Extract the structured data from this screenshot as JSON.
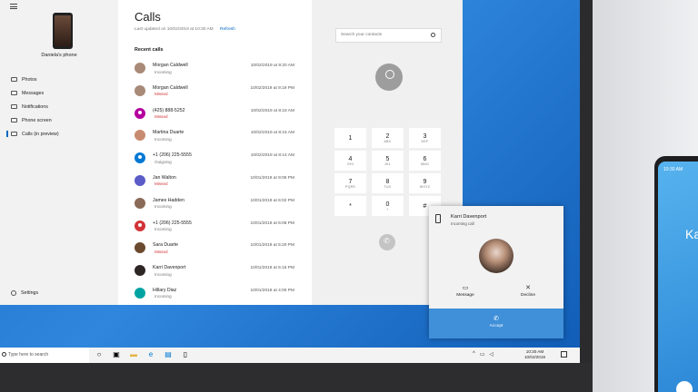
{
  "app": {
    "device_name": "Daniela's phone",
    "nav": [
      {
        "label": "Photos",
        "icon": "photos-icon"
      },
      {
        "label": "Messages",
        "icon": "messages-icon"
      },
      {
        "label": "Notifications",
        "icon": "notifications-icon"
      },
      {
        "label": "Phone screen",
        "icon": "phone-screen-icon"
      },
      {
        "label": "Calls (in preview)",
        "icon": "calls-icon",
        "active": true
      }
    ],
    "settings_label": "Settings"
  },
  "calls": {
    "title": "Calls",
    "last_updated": "Last updated on 10/02/2019 at 10:30 AM",
    "refresh_label": "Refresh",
    "recent_label": "Recent calls",
    "items": [
      {
        "name": "Morgan Caldwell",
        "type": "Incoming",
        "time": "10/02/2019 at 9:20 AM",
        "color": "#a88a78"
      },
      {
        "name": "Morgan Caldwell",
        "type": "Missed",
        "time": "10/02/2019 at 9:19 PM",
        "color": "#a88a78"
      },
      {
        "name": "(425) 888-5252",
        "type": "Missed",
        "time": "10/02/2019 at 8:18 AM",
        "color": "#b4009e"
      },
      {
        "name": "Martina Duarte",
        "type": "Incoming",
        "time": "10/02/2019 at 8:15 AM",
        "color": "#c98b6f"
      },
      {
        "name": "+1 (206) 225-5555",
        "type": "Outgoing",
        "time": "10/02/2019 at 8:14 AM",
        "color": "#0078d4"
      },
      {
        "name": "Jan Walton",
        "type": "Missed",
        "time": "10/01/2019 at 9:05 PM",
        "color": "#5c5cc8"
      },
      {
        "name": "James Hadden",
        "type": "Incoming",
        "time": "10/01/2019 at 6:02 PM",
        "color": "#8a6a58"
      },
      {
        "name": "+1 (206) 225-5555",
        "type": "Incoming",
        "time": "10/01/2019 at 6:08 PM",
        "color": "#d13438"
      },
      {
        "name": "Sara Duarte",
        "type": "Missed",
        "time": "10/01/2019 at 5:20 PM",
        "color": "#6b4a2e"
      },
      {
        "name": "Karri Davenport",
        "type": "Incoming",
        "time": "10/01/2019 at 5:15 PM",
        "color": "#2e2624"
      },
      {
        "name": "Hillary Diaz",
        "type": "Incoming",
        "time": "10/01/2019 at 4:00 PM",
        "color": "#00a3a3"
      }
    ]
  },
  "dialer": {
    "search_placeholder": "Search your contacts",
    "keys": [
      {
        "num": "1",
        "sub": ""
      },
      {
        "num": "2",
        "sub": "ABC"
      },
      {
        "num": "3",
        "sub": "DEF"
      },
      {
        "num": "4",
        "sub": "GHI"
      },
      {
        "num": "5",
        "sub": "JKL"
      },
      {
        "num": "6",
        "sub": "MNO"
      },
      {
        "num": "7",
        "sub": "PQRS"
      },
      {
        "num": "8",
        "sub": "TUV"
      },
      {
        "num": "9",
        "sub": "WXYZ"
      },
      {
        "num": "*",
        "sub": ""
      },
      {
        "num": "0",
        "sub": "+"
      },
      {
        "num": "#",
        "sub": ""
      }
    ]
  },
  "toast": {
    "caller_name": "Karri Davenport",
    "subtitle": "Incoming call",
    "message_label": "Message",
    "decline_label": "Decline",
    "accept_label": "Accept"
  },
  "taskbar": {
    "search_label": "Type here to search",
    "time": "10:30 AM",
    "date": "10/02/2019"
  },
  "phone": {
    "status_time": "10:30 AM",
    "caller_initial": "Ka"
  },
  "colors": {
    "accent": "#0067c0",
    "missed": "#d13438",
    "accept": "#3f8fd9",
    "desktop": "#1d6fc7"
  }
}
